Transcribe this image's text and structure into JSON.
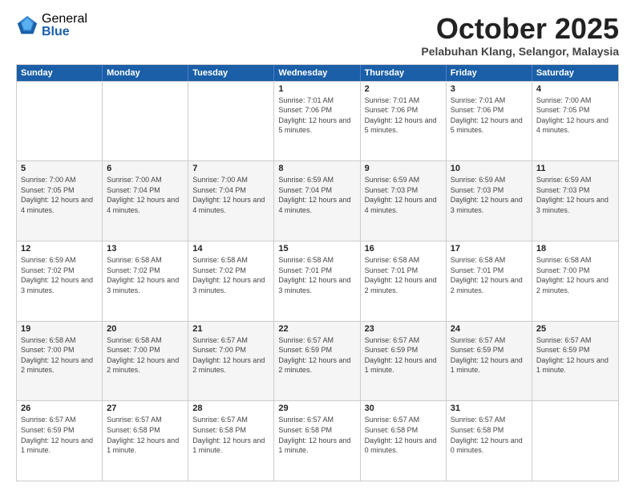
{
  "logo": {
    "general": "General",
    "blue": "Blue"
  },
  "header": {
    "month": "October 2025",
    "location": "Pelabuhan Klang, Selangor, Malaysia"
  },
  "weekdays": [
    "Sunday",
    "Monday",
    "Tuesday",
    "Wednesday",
    "Thursday",
    "Friday",
    "Saturday"
  ],
  "rows": [
    {
      "bg": "light",
      "cells": [
        {
          "day": "",
          "sunrise": "",
          "sunset": "",
          "daylight": ""
        },
        {
          "day": "",
          "sunrise": "",
          "sunset": "",
          "daylight": ""
        },
        {
          "day": "",
          "sunrise": "",
          "sunset": "",
          "daylight": ""
        },
        {
          "day": "1",
          "sunrise": "Sunrise: 7:01 AM",
          "sunset": "Sunset: 7:06 PM",
          "daylight": "Daylight: 12 hours and 5 minutes."
        },
        {
          "day": "2",
          "sunrise": "Sunrise: 7:01 AM",
          "sunset": "Sunset: 7:06 PM",
          "daylight": "Daylight: 12 hours and 5 minutes."
        },
        {
          "day": "3",
          "sunrise": "Sunrise: 7:01 AM",
          "sunset": "Sunset: 7:06 PM",
          "daylight": "Daylight: 12 hours and 5 minutes."
        },
        {
          "day": "4",
          "sunrise": "Sunrise: 7:00 AM",
          "sunset": "Sunset: 7:05 PM",
          "daylight": "Daylight: 12 hours and 4 minutes."
        }
      ]
    },
    {
      "bg": "gray",
      "cells": [
        {
          "day": "5",
          "sunrise": "Sunrise: 7:00 AM",
          "sunset": "Sunset: 7:05 PM",
          "daylight": "Daylight: 12 hours and 4 minutes."
        },
        {
          "day": "6",
          "sunrise": "Sunrise: 7:00 AM",
          "sunset": "Sunset: 7:04 PM",
          "daylight": "Daylight: 12 hours and 4 minutes."
        },
        {
          "day": "7",
          "sunrise": "Sunrise: 7:00 AM",
          "sunset": "Sunset: 7:04 PM",
          "daylight": "Daylight: 12 hours and 4 minutes."
        },
        {
          "day": "8",
          "sunrise": "Sunrise: 6:59 AM",
          "sunset": "Sunset: 7:04 PM",
          "daylight": "Daylight: 12 hours and 4 minutes."
        },
        {
          "day": "9",
          "sunrise": "Sunrise: 6:59 AM",
          "sunset": "Sunset: 7:03 PM",
          "daylight": "Daylight: 12 hours and 4 minutes."
        },
        {
          "day": "10",
          "sunrise": "Sunrise: 6:59 AM",
          "sunset": "Sunset: 7:03 PM",
          "daylight": "Daylight: 12 hours and 3 minutes."
        },
        {
          "day": "11",
          "sunrise": "Sunrise: 6:59 AM",
          "sunset": "Sunset: 7:03 PM",
          "daylight": "Daylight: 12 hours and 3 minutes."
        }
      ]
    },
    {
      "bg": "light",
      "cells": [
        {
          "day": "12",
          "sunrise": "Sunrise: 6:59 AM",
          "sunset": "Sunset: 7:02 PM",
          "daylight": "Daylight: 12 hours and 3 minutes."
        },
        {
          "day": "13",
          "sunrise": "Sunrise: 6:58 AM",
          "sunset": "Sunset: 7:02 PM",
          "daylight": "Daylight: 12 hours and 3 minutes."
        },
        {
          "day": "14",
          "sunrise": "Sunrise: 6:58 AM",
          "sunset": "Sunset: 7:02 PM",
          "daylight": "Daylight: 12 hours and 3 minutes."
        },
        {
          "day": "15",
          "sunrise": "Sunrise: 6:58 AM",
          "sunset": "Sunset: 7:01 PM",
          "daylight": "Daylight: 12 hours and 3 minutes."
        },
        {
          "day": "16",
          "sunrise": "Sunrise: 6:58 AM",
          "sunset": "Sunset: 7:01 PM",
          "daylight": "Daylight: 12 hours and 2 minutes."
        },
        {
          "day": "17",
          "sunrise": "Sunrise: 6:58 AM",
          "sunset": "Sunset: 7:01 PM",
          "daylight": "Daylight: 12 hours and 2 minutes."
        },
        {
          "day": "18",
          "sunrise": "Sunrise: 6:58 AM",
          "sunset": "Sunset: 7:00 PM",
          "daylight": "Daylight: 12 hours and 2 minutes."
        }
      ]
    },
    {
      "bg": "gray",
      "cells": [
        {
          "day": "19",
          "sunrise": "Sunrise: 6:58 AM",
          "sunset": "Sunset: 7:00 PM",
          "daylight": "Daylight: 12 hours and 2 minutes."
        },
        {
          "day": "20",
          "sunrise": "Sunrise: 6:58 AM",
          "sunset": "Sunset: 7:00 PM",
          "daylight": "Daylight: 12 hours and 2 minutes."
        },
        {
          "day": "21",
          "sunrise": "Sunrise: 6:57 AM",
          "sunset": "Sunset: 7:00 PM",
          "daylight": "Daylight: 12 hours and 2 minutes."
        },
        {
          "day": "22",
          "sunrise": "Sunrise: 6:57 AM",
          "sunset": "Sunset: 6:59 PM",
          "daylight": "Daylight: 12 hours and 2 minutes."
        },
        {
          "day": "23",
          "sunrise": "Sunrise: 6:57 AM",
          "sunset": "Sunset: 6:59 PM",
          "daylight": "Daylight: 12 hours and 1 minute."
        },
        {
          "day": "24",
          "sunrise": "Sunrise: 6:57 AM",
          "sunset": "Sunset: 6:59 PM",
          "daylight": "Daylight: 12 hours and 1 minute."
        },
        {
          "day": "25",
          "sunrise": "Sunrise: 6:57 AM",
          "sunset": "Sunset: 6:59 PM",
          "daylight": "Daylight: 12 hours and 1 minute."
        }
      ]
    },
    {
      "bg": "light",
      "cells": [
        {
          "day": "26",
          "sunrise": "Sunrise: 6:57 AM",
          "sunset": "Sunset: 6:59 PM",
          "daylight": "Daylight: 12 hours and 1 minute."
        },
        {
          "day": "27",
          "sunrise": "Sunrise: 6:57 AM",
          "sunset": "Sunset: 6:58 PM",
          "daylight": "Daylight: 12 hours and 1 minute."
        },
        {
          "day": "28",
          "sunrise": "Sunrise: 6:57 AM",
          "sunset": "Sunset: 6:58 PM",
          "daylight": "Daylight: 12 hours and 1 minute."
        },
        {
          "day": "29",
          "sunrise": "Sunrise: 6:57 AM",
          "sunset": "Sunset: 6:58 PM",
          "daylight": "Daylight: 12 hours and 1 minute."
        },
        {
          "day": "30",
          "sunrise": "Sunrise: 6:57 AM",
          "sunset": "Sunset: 6:58 PM",
          "daylight": "Daylight: 12 hours and 0 minutes."
        },
        {
          "day": "31",
          "sunrise": "Sunrise: 6:57 AM",
          "sunset": "Sunset: 6:58 PM",
          "daylight": "Daylight: 12 hours and 0 minutes."
        },
        {
          "day": "",
          "sunrise": "",
          "sunset": "",
          "daylight": ""
        }
      ]
    }
  ]
}
